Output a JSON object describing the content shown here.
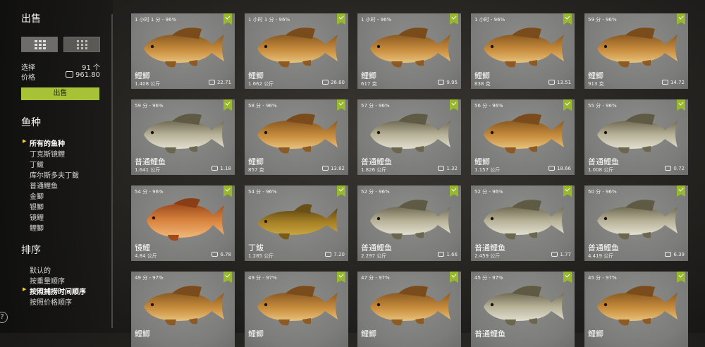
{
  "sidebar": {
    "sell_title": "出售",
    "selected_label": "选择",
    "selected_value": "91 个",
    "price_label": "价格",
    "price_value": "961.80",
    "sell_button": "出售",
    "species_title": "鱼种",
    "species": [
      "所有的鱼种",
      "丁克斯镜鲤",
      "丁鲅",
      "库尔斯多夫丁鲅",
      "普通鲤鱼",
      "金鲫",
      "银鲫",
      "镜鲤",
      "鲤鲫"
    ],
    "sort_title": "排序",
    "sort": [
      "默认的",
      "按重量顺序",
      "按照捕捞时间顺序",
      "按照价格顺序"
    ],
    "help": "?"
  },
  "colors": {
    "accent": "#a8c238",
    "check": "#98b82e"
  },
  "cards": [
    {
      "info": "1 小时 1 分 - 96%",
      "name": "鲤鲫",
      "weight": "1.408 公斤",
      "price": "22.71",
      "fish": "golden"
    },
    {
      "info": "1 小时 1 分 - 96%",
      "name": "鲤鲫",
      "weight": "1.662 公斤",
      "price": "26.80",
      "fish": "golden"
    },
    {
      "info": "1 小时 - 96%",
      "name": "鲤鲫",
      "weight": "617 克",
      "price": "9.95",
      "fish": "golden"
    },
    {
      "info": "1 小时 - 96%",
      "name": "鲤鲫",
      "weight": "838 克",
      "price": "13.51",
      "fish": "golden"
    },
    {
      "info": "59 分 - 96%",
      "name": "鲤鲫",
      "weight": "913 克",
      "price": "14.72",
      "fish": "golden"
    },
    {
      "info": "59 分 - 96%",
      "name": "普通鲤鱼",
      "weight": "1.641 公斤",
      "price": "1.18",
      "fish": "silver"
    },
    {
      "info": "58 分 - 96%",
      "name": "鲤鲫",
      "weight": "857 克",
      "price": "13.82",
      "fish": "golden"
    },
    {
      "info": "57 分 - 96%",
      "name": "普通鲤鱼",
      "weight": "1.826 公斤",
      "price": "1.32",
      "fish": "silver"
    },
    {
      "info": "56 分 - 96%",
      "name": "鲤鲫",
      "weight": "1.157 公斤",
      "price": "18.66",
      "fish": "golden"
    },
    {
      "info": "55 分 - 96%",
      "name": "普通鲤鱼",
      "weight": "1.008 公斤",
      "price": "0.72",
      "fish": "silver"
    },
    {
      "info": "54 分 - 96%",
      "name": "镜鲤",
      "weight": "4.84 公斤",
      "price": "6.78",
      "fish": "mirror"
    },
    {
      "info": "54 分 - 96%",
      "name": "丁鲅",
      "weight": "1.285 公斤",
      "price": "7.20",
      "fish": "tench"
    },
    {
      "info": "52 分 - 96%",
      "name": "普通鲤鱼",
      "weight": "2.297 公斤",
      "price": "1.66",
      "fish": "silver"
    },
    {
      "info": "52 分 - 96%",
      "name": "普通鲤鱼",
      "weight": "2.459 公斤",
      "price": "1.77",
      "fish": "silver"
    },
    {
      "info": "50 分 - 96%",
      "name": "普通鲤鱼",
      "weight": "4.419 公斤",
      "price": "6.39",
      "fish": "silver"
    },
    {
      "info": "49 分 - 97%",
      "name": "鲤鲫",
      "weight": "",
      "price": "",
      "fish": "golden"
    },
    {
      "info": "49 分 - 97%",
      "name": "鲤鲫",
      "weight": "",
      "price": "",
      "fish": "golden"
    },
    {
      "info": "47 分 - 97%",
      "name": "鲤鲫",
      "weight": "",
      "price": "",
      "fish": "golden"
    },
    {
      "info": "45 分 - 97%",
      "name": "普通鲤鱼",
      "weight": "",
      "price": "",
      "fish": "silver"
    },
    {
      "info": "45 分 - 97%",
      "name": "鲤鲫",
      "weight": "",
      "price": "",
      "fish": "golden"
    }
  ]
}
